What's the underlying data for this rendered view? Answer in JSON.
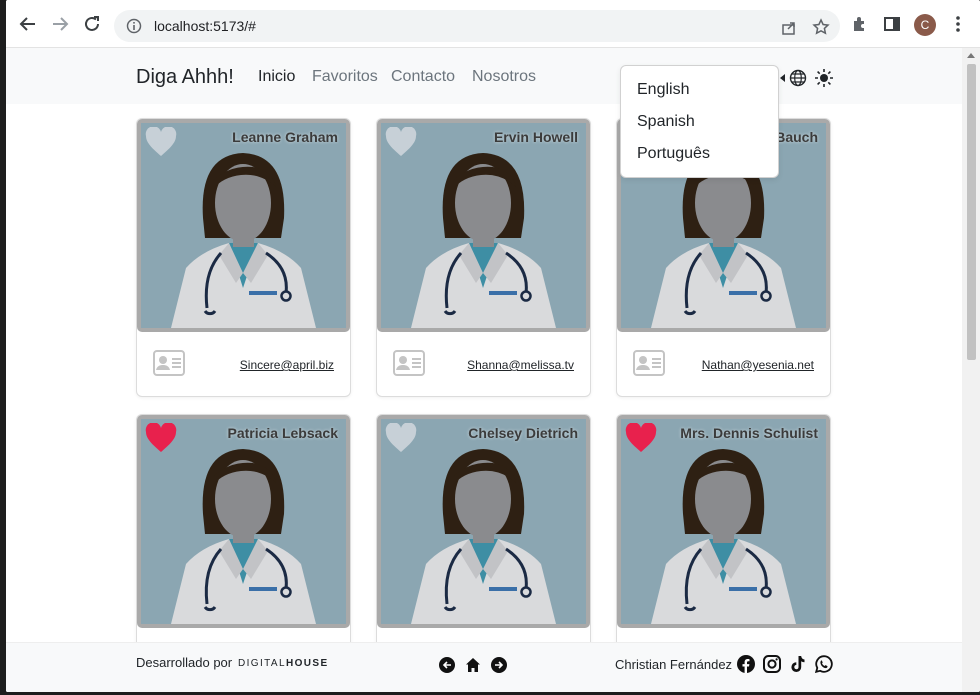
{
  "browser": {
    "url": "localhost:5173/#",
    "profile_initial": "C"
  },
  "app": {
    "brand": "Diga Ahhh!",
    "nav": [
      {
        "label": "Inicio",
        "active": true
      },
      {
        "label": "Favoritos",
        "active": false
      },
      {
        "label": "Contacto",
        "active": false
      },
      {
        "label": "Nosotros",
        "active": false
      }
    ],
    "language_menu": [
      "English",
      "Spanish",
      "Português"
    ]
  },
  "cards": [
    {
      "name": "Leanne Graham",
      "email": "Sincere@april.biz",
      "favorite": false
    },
    {
      "name": "Ervin Howell",
      "email": "Shanna@melissa.tv",
      "favorite": false
    },
    {
      "name": "Clementine Bauch",
      "email": "Nathan@yesenia.net",
      "favorite": false
    },
    {
      "name": "Patricia Lebsack",
      "email": "",
      "favorite": true
    },
    {
      "name": "Chelsey Dietrich",
      "email": "",
      "favorite": false
    },
    {
      "name": "Mrs. Dennis Schulist",
      "email": "",
      "favorite": true
    }
  ],
  "footer": {
    "developed_by": "Desarrollado por",
    "brand_light": "DIGITAL",
    "brand_bold": "HOUSE",
    "author": "Christian Fernández"
  },
  "colors": {
    "heart_on": "#e8214d",
    "heart_off": "#c7d0d7",
    "card_bg": "#8ba6b2"
  }
}
